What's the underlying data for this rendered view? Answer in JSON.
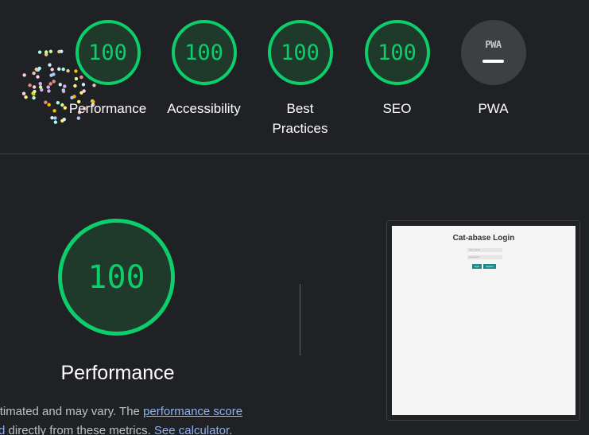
{
  "summary": {
    "gauges": [
      {
        "id": "performance",
        "score": "100",
        "label": "Performance"
      },
      {
        "id": "accessibility",
        "score": "100",
        "label": "Accessibility"
      },
      {
        "id": "best-practices",
        "score": "100",
        "label": "Best Practices"
      },
      {
        "id": "seo",
        "score": "100",
        "label": "SEO"
      },
      {
        "id": "pwa",
        "badge": "PWA",
        "label": "PWA"
      }
    ],
    "colors": {
      "pass": "#0cce6b",
      "pwa_bg": "#3c4043"
    }
  },
  "performance": {
    "score": "100",
    "title": "Performance",
    "desc_start": "are estimated and may vary. The ",
    "desc_link1_a": "performance score",
    "desc_link1_b": "culated",
    "desc_middle": " directly from these metrics. ",
    "desc_link2": "See calculator",
    "desc_end": "."
  },
  "screenshot": {
    "title": "Cat-abase Login",
    "username_placeholder": "user name",
    "password_placeholder": "password",
    "login_label": "login",
    "register_label": "register"
  }
}
